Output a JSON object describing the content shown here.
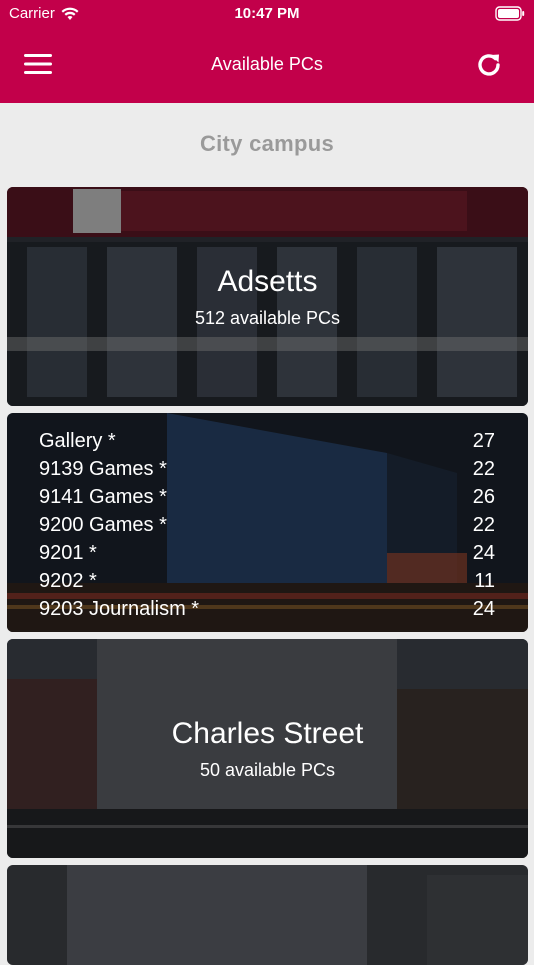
{
  "status": {
    "carrier": "Carrier",
    "time": "10:47 PM"
  },
  "navbar": {
    "title": "Available PCs",
    "menu_icon": "hamburger-icon",
    "refresh_icon": "refresh-icon"
  },
  "section": {
    "title": "City campus"
  },
  "cards": [
    {
      "name": "Adsetts",
      "count": "512 available PCs"
    },
    {
      "name": "Charles Street",
      "count": "50 available PCs"
    }
  ],
  "rooms": [
    {
      "name": "Gallery *",
      "count": "27"
    },
    {
      "name": "9139 Games *",
      "count": "22"
    },
    {
      "name": "9141 Games *",
      "count": "26"
    },
    {
      "name": "9200 Games *",
      "count": "22"
    },
    {
      "name": "9201 *",
      "count": "24"
    },
    {
      "name": "9202 *",
      "count": "11"
    },
    {
      "name": "9203 Journalism *",
      "count": "24"
    }
  ],
  "colors": {
    "brand": "#c2004a",
    "background": "#ececec",
    "section_title": "#9a9a9a"
  }
}
